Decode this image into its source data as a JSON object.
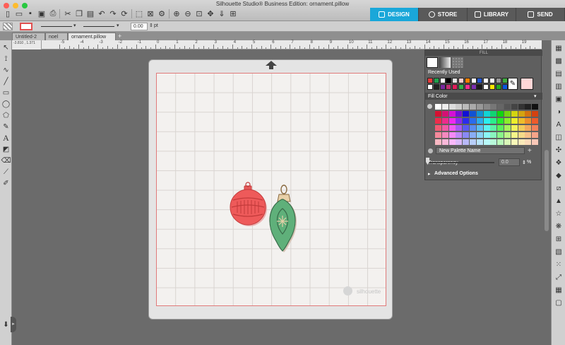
{
  "window": {
    "title": "Silhouette Studio® Business Edition: ornament.pillow"
  },
  "mode_tabs": [
    {
      "label": "DESIGN",
      "active": true
    },
    {
      "label": "STORE",
      "active": false
    },
    {
      "label": "LIBRARY",
      "active": false
    },
    {
      "label": "SEND",
      "active": false
    }
  ],
  "toolbar2": {
    "line_width": "0.00",
    "unit": "pt"
  },
  "doc_tabs": [
    {
      "label": "Untitled-2",
      "active": false
    },
    {
      "label": "noel",
      "active": false
    },
    {
      "label": "ornament.pillow",
      "active": true
    }
  ],
  "ruler": {
    "coord": "-3.810 , 1.371",
    "numbers": [
      "-5",
      "-4",
      "-3",
      "-2",
      "-1",
      "0",
      "1",
      "2",
      "3",
      "4",
      "5",
      "6",
      "7",
      "8",
      "9",
      "10",
      "11",
      "12",
      "13",
      "14",
      "15",
      "16",
      "17",
      "18",
      "19"
    ]
  },
  "canvas": {
    "watermark": "silhouette"
  },
  "fill_panel": {
    "header": "FILL",
    "recently_used_label": "Recently Used",
    "fill_color_label": "Fill Color",
    "palette_name": "New Palette Name",
    "add_symbol": "+",
    "transparency_label": "Transparency",
    "transparency_value": "0.0",
    "percent": "%",
    "advanced_label": "Advanced Options",
    "recent_colors": [
      "#e73b3b",
      "#20a04b",
      "#ffffff",
      "#000000",
      "#e6e6e6",
      "#ffcfcf",
      "#ff7f00",
      "#ffffff",
      "#2255cc",
      "#ffffff",
      "#ffffff",
      "#9a9a9a",
      "#3caa3c",
      "#ffffff",
      "#222222",
      "#7a2aa0",
      "#c03070",
      "#e01e5a",
      "#36b24a",
      "#ff3090",
      "#7b2fb0",
      "#1a1a1a",
      "#ffffff",
      "#ffe600",
      "#22aa22",
      "#0a55dd"
    ],
    "selected_color": "#ffd6d6"
  }
}
